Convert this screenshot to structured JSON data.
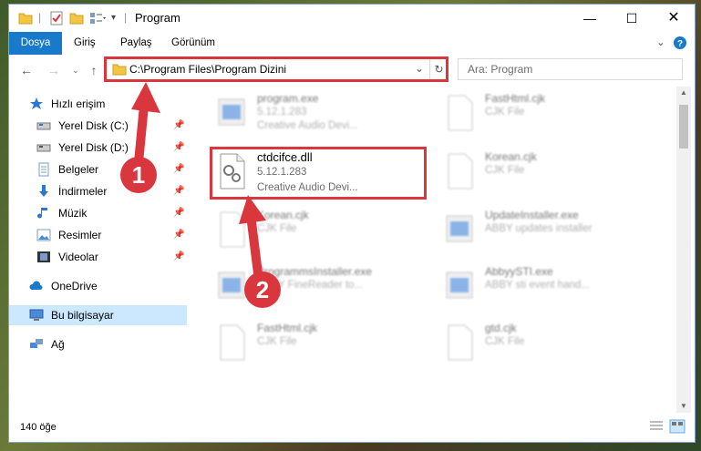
{
  "window": {
    "title": "Program"
  },
  "ribbon": {
    "tabs": [
      "Dosya",
      "Giriş",
      "Paylaş",
      "Görünüm"
    ]
  },
  "address": {
    "path": "C:\\Program Files\\Program Dizini"
  },
  "search": {
    "placeholder": "Ara: Program"
  },
  "sidebar": {
    "items": [
      {
        "label": "Hızlı erişim"
      },
      {
        "label": "Yerel Disk (C:)"
      },
      {
        "label": "Yerel Disk (D:)"
      },
      {
        "label": "Belgeler"
      },
      {
        "label": "İndirmeler"
      },
      {
        "label": "Müzik"
      },
      {
        "label": "Resimler"
      },
      {
        "label": "Videolar"
      },
      {
        "label": "OneDrive"
      },
      {
        "label": "Bu bilgisayar"
      },
      {
        "label": "Ağ"
      }
    ]
  },
  "files": [
    {
      "name": "program.exe",
      "line1": "5.12.1.283",
      "line2": "Creative Audio Devi..."
    },
    {
      "name": "FastHtml.cjk",
      "line1": "CJK File",
      "line2": ""
    },
    {
      "name": "ctdcifce.dll",
      "line1": "5.12.1.283",
      "line2": "Creative Audio Devi..."
    },
    {
      "name": "Korean.cjk",
      "line1": "CJK File",
      "line2": ""
    },
    {
      "name": "Korean.cjk",
      "line1": "CJK File",
      "line2": ""
    },
    {
      "name": "UpdateInstaller.exe",
      "line1": "ABBY updates installer",
      "line2": ""
    },
    {
      "name": "ProgrammsInstaller.exe",
      "line1": "ABBY FineReader to...",
      "line2": ""
    },
    {
      "name": "AbbyySTI.exe",
      "line1": "ABBY sti event hand...",
      "line2": ""
    },
    {
      "name": "FastHtml.cjk",
      "line1": "CJK File",
      "line2": ""
    },
    {
      "name": "gtd.cjk",
      "line1": "CJK File",
      "line2": ""
    }
  ],
  "status": {
    "count": "140 öğe"
  },
  "annotations": {
    "step1": "1",
    "step2": "2"
  },
  "colors": {
    "accent": "#1979ca",
    "highlight": "#d9363e",
    "selected": "#cce8ff"
  }
}
